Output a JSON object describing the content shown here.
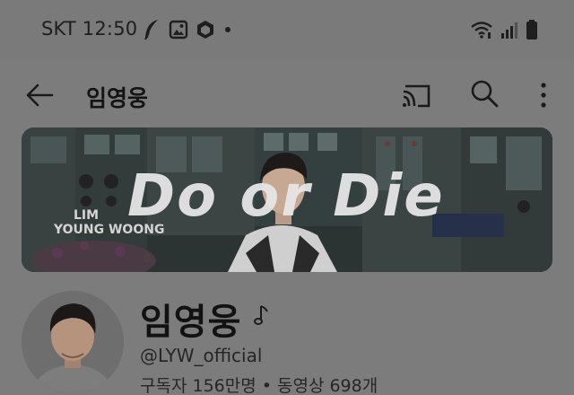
{
  "status_bar": {
    "carrier": "SKT",
    "time": "12:50"
  },
  "app_bar": {
    "title": "임영웅"
  },
  "banner": {
    "logo_text": "Do or Die",
    "artist_line1": "LIM",
    "artist_line2": "YOUNG WOONG"
  },
  "channel": {
    "name": "임영웅",
    "handle": "@LYW_official",
    "stats": "구독자 156만명 • 동영상 698개"
  },
  "colors": {
    "overlay_bg": "#7c7c7c",
    "text_dark": "#141414"
  }
}
